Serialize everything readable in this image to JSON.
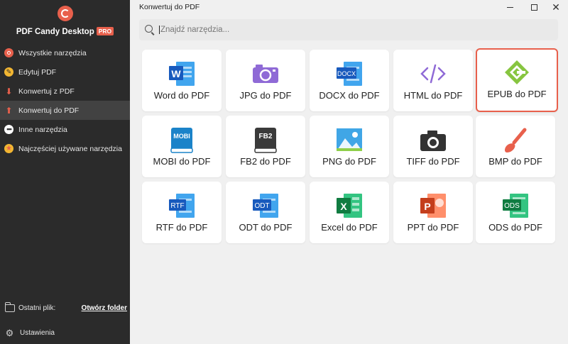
{
  "app": {
    "brand": "PDF Candy Desktop",
    "pro_badge": "PRO",
    "accent": "#e8604c"
  },
  "sidebar": {
    "items": [
      {
        "label": "Wszystkie narzędzia",
        "icon": "all-tools-icon",
        "color": "#e8604c",
        "active": false
      },
      {
        "label": "Edytuj PDF",
        "icon": "edit-pdf-icon",
        "color": "#f2b632",
        "active": false
      },
      {
        "label": "Konwertuj z PDF",
        "icon": "convert-from-pdf-icon",
        "color": "#e8604c",
        "active": false
      },
      {
        "label": "Konwertuj do PDF",
        "icon": "convert-to-pdf-icon",
        "color": "#e8604c",
        "active": true
      },
      {
        "label": "Inne narzędzia",
        "icon": "more-tools-icon",
        "color": "#ffffff",
        "active": false
      },
      {
        "label": "Najczęściej używane narzędzia",
        "icon": "favorite-star-icon",
        "color": "#f2b632",
        "active": false
      }
    ],
    "recent_label": "Ostatni plik:",
    "open_folder": "Otwórz folder",
    "settings": "Ustawienia"
  },
  "header": {
    "title": "Konwertuj do PDF"
  },
  "search": {
    "placeholder": "Znajdź narzędzia..."
  },
  "tools": [
    {
      "label": "Word do PDF",
      "icon": "word-file-icon",
      "selected": false
    },
    {
      "label": "JPG do PDF",
      "icon": "jpg-camera-icon",
      "selected": false
    },
    {
      "label": "DOCX do PDF",
      "icon": "docx-file-icon",
      "selected": false
    },
    {
      "label": "HTML do PDF",
      "icon": "html-code-icon",
      "selected": false
    },
    {
      "label": "EPUB do PDF",
      "icon": "epub-icon",
      "selected": true
    },
    {
      "label": "MOBI do PDF",
      "icon": "mobi-book-icon",
      "selected": false
    },
    {
      "label": "FB2 do PDF",
      "icon": "fb2-book-icon",
      "selected": false
    },
    {
      "label": "PNG do PDF",
      "icon": "png-image-icon",
      "selected": false
    },
    {
      "label": "TIFF do PDF",
      "icon": "tiff-camera-icon",
      "selected": false
    },
    {
      "label": "BMP do PDF",
      "icon": "bmp-brush-icon",
      "selected": false
    },
    {
      "label": "RTF do PDF",
      "icon": "rtf-file-icon",
      "selected": false
    },
    {
      "label": "ODT do PDF",
      "icon": "odt-file-icon",
      "selected": false
    },
    {
      "label": "Excel do PDF",
      "icon": "excel-file-icon",
      "selected": false
    },
    {
      "label": "PPT do PDF",
      "icon": "ppt-file-icon",
      "selected": false
    },
    {
      "label": "ODS do PDF",
      "icon": "ods-file-icon",
      "selected": false
    }
  ],
  "icon_text": {
    "word": "W",
    "docx": "DOCX",
    "mobi": "MOBI",
    "fb2": "FB2",
    "rtf": "RTF",
    "odt": "ODT",
    "excel": "X",
    "ppt": "P",
    "ods": "ODS"
  }
}
